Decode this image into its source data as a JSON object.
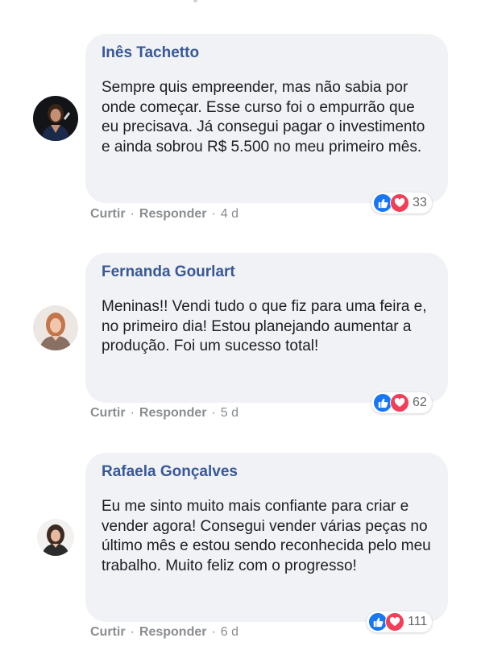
{
  "theme": {
    "author_color": "#385898",
    "bubble_bg": "#f0f2f5",
    "like_color": "#1877f2",
    "love_color": "#f33e58"
  },
  "actions": {
    "like_label": "Curtir",
    "reply_label": "Responder",
    "separator": "·"
  },
  "comments": [
    {
      "author": "Inês Tachetto",
      "text": "Sempre quis empreender, mas não sabia por onde começar. Esse curso foi o empurrão que eu precisava. Já consegui pagar o investimento e ainda sobrou R$ 5.500 no meu primeiro mês.",
      "reaction_icons": [
        "like-icon",
        "heart-icon"
      ],
      "reaction_count": "33",
      "time": "4 d"
    },
    {
      "author": "Fernanda Gourlart",
      "text": "Meninas!! Vendi tudo o que fiz para uma feira e, no primeiro dia! Estou planejando aumentar a produção. Foi um sucesso total!",
      "reaction_icons": [
        "like-icon",
        "heart-icon"
      ],
      "reaction_count": "62",
      "time": "5 d"
    },
    {
      "author": "Rafaela Gonçalves",
      "text": "Eu me sinto muito mais confiante para criar e vender agora! Consegui vender várias peças no último mês e estou sendo reconhecida pelo meu trabalho. Muito feliz com o progresso!",
      "reaction_icons": [
        "like-icon",
        "heart-icon"
      ],
      "reaction_count": "111",
      "time": "6 d"
    }
  ]
}
